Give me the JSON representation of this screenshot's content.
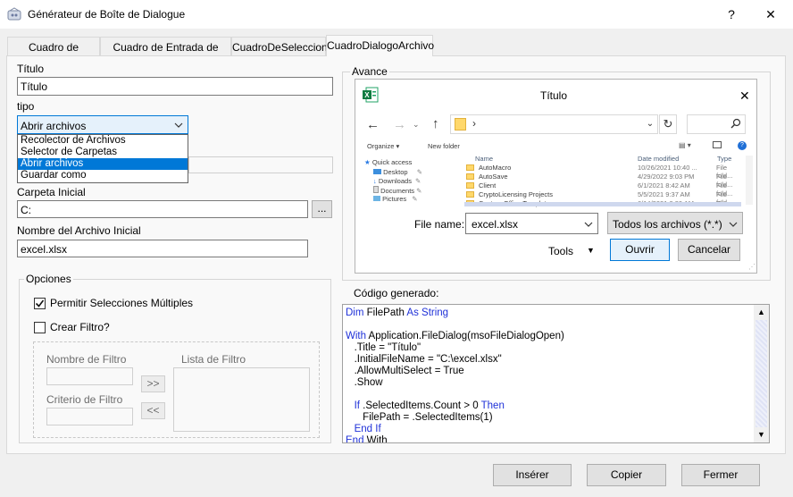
{
  "window": {
    "title": "Générateur de Boîte de Dialogue",
    "help_label": "?",
    "close_label": "✕"
  },
  "tabs": [
    {
      "label": "Cuadro de Mensaje"
    },
    {
      "label": "Cuadro de Entrada de Texto"
    },
    {
      "label": "CuadroDeSeleccion"
    },
    {
      "label": "CuadroDialogoArchivo"
    }
  ],
  "form": {
    "titulo_label": "Título",
    "titulo_value": "Título",
    "tipo_label": "tipo",
    "tipo_value": "Abrir archivos",
    "tipo_options": [
      "Recolector de Archivos",
      "Selector de Carpetas",
      "Abrir archivos",
      "Guardar como"
    ],
    "carpeta_label": "Carpeta Inicial",
    "carpeta_value": "C:",
    "browse_label": "...",
    "nombre_label": "Nombre del Archivo Inicial",
    "nombre_value": "excel.xlsx"
  },
  "opciones": {
    "title": "Opciones",
    "multi_label": "Permitir Selecciones Múltiples",
    "multi_checked": true,
    "filtro_label": "Crear Filtro?",
    "filtro_checked": false,
    "nombre_filtro_label": "Nombre de Filtro",
    "criterio_label": "Criterio de Filtro",
    "lista_label": "Lista de Filtro",
    "add_label": ">>",
    "remove_label": "<<"
  },
  "avance": {
    "title": "Avance",
    "dialog_title": "Título",
    "organize": "Organize ▾",
    "new_folder": "New folder",
    "col_name": "Name",
    "col_date": "Date modified",
    "col_type": "Type",
    "nav": [
      "Quick access",
      "Desktop",
      "Downloads",
      "Documents",
      "Pictures"
    ],
    "files": [
      {
        "name": "AutoMacro",
        "date": "10/26/2021 10:40 ...",
        "type": "File fold..."
      },
      {
        "name": "AutoSave",
        "date": "4/29/2022 9:03 PM",
        "type": "File fold..."
      },
      {
        "name": "Client",
        "date": "6/1/2021 8:42 AM",
        "type": "File fold..."
      },
      {
        "name": "CryptoLicensing Projects",
        "date": "5/5/2021 9:37 AM",
        "type": "File fold..."
      },
      {
        "name": "Custom Office Templates",
        "date": "6/14/2021 3:30 AM",
        "type": "File fold..."
      }
    ],
    "file_name_label": "File name:",
    "file_name_value": "excel.xlsx",
    "filter_value": "Todos los archivos (*.*)",
    "tools_label": "Tools",
    "open_label": "Ouvrir",
    "cancel_label": "Cancelar"
  },
  "codigo": {
    "title": "Código generado:",
    "lines": [
      "Dim FilePath As String",
      "",
      "With Application.FileDialog(msoFileDialogOpen)",
      "   .Title = \"Título\"",
      "   .InitialFileName = \"C:\\excel.xlsx\"",
      "   .AllowMultiSelect = True",
      "   .Show",
      "",
      "   If .SelectedItems.Count > 0 Then",
      "      FilePath = .SelectedItems(1)",
      "   End If",
      "End With"
    ]
  },
  "buttons": {
    "insert": "Insérer",
    "copy": "Copier",
    "close": "Fermer"
  }
}
